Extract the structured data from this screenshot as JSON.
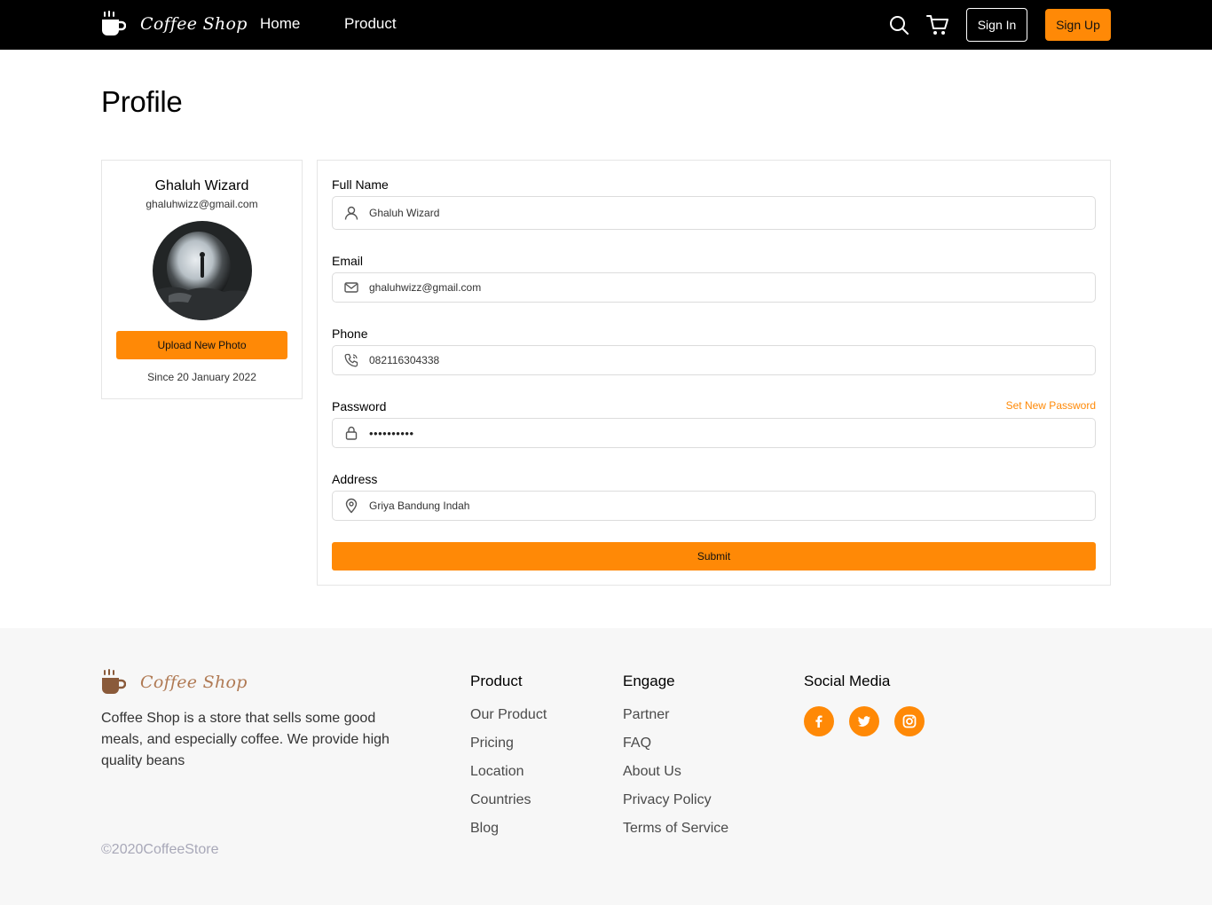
{
  "brand": {
    "name": "Coffee Shop"
  },
  "nav": {
    "links": [
      "Home",
      "Product"
    ],
    "signin_label": "Sign In",
    "signup_label": "Sign Up"
  },
  "page": {
    "title": "Profile"
  },
  "profile_card": {
    "name": "Ghaluh Wizard",
    "email": "ghaluhwizz@gmail.com",
    "upload_label": "Upload New Photo",
    "since": "Since 20 January 2022"
  },
  "form": {
    "full_name": {
      "label": "Full Name",
      "value": "Ghaluh Wizard",
      "icon": "user-icon"
    },
    "email": {
      "label": "Email",
      "value": "ghaluhwizz@gmail.com",
      "icon": "mail-icon"
    },
    "phone": {
      "label": "Phone",
      "value": "082116304338",
      "icon": "phone-icon"
    },
    "password": {
      "label": "Password",
      "value": "••••••••••",
      "icon": "lock-icon",
      "set_new_label": "Set New Password"
    },
    "address": {
      "label": "Address",
      "value": "Griya Bandung Indah",
      "icon": "location-pin-icon"
    },
    "submit_label": "Submit"
  },
  "footer": {
    "description": "Coffee Shop is a store that sells some good meals, and especially coffee. We provide high quality beans",
    "copyright": "©2020CoffeeStore",
    "product": {
      "title": "Product",
      "items": [
        "Our Product",
        "Pricing",
        "Location",
        "Countries",
        "Blog"
      ]
    },
    "engage": {
      "title": "Engage",
      "items": [
        "Partner",
        "FAQ",
        "About Us",
        "Privacy Policy",
        "Terms of Service"
      ]
    },
    "social": {
      "title": "Social Media",
      "icons": [
        "facebook-icon",
        "twitter-icon",
        "instagram-icon"
      ]
    }
  },
  "colors": {
    "accent": "#ff8906",
    "navbar": "#000000",
    "footer_bg": "#f7f7f7",
    "brand_footer": "#b07a54"
  }
}
